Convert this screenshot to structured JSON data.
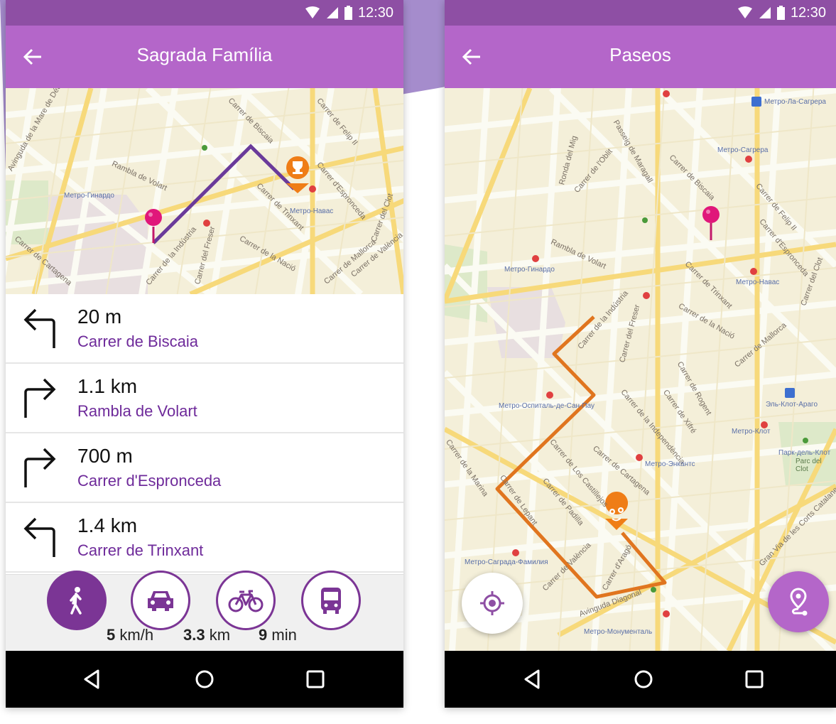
{
  "left_screen": {
    "status_time": "12:30",
    "title": "Sagrada Família",
    "map_labels": [
      {
        "text": "Avinguda de la Mare de Déu de Montserrat"
      },
      {
        "text": "Rambla de Volart"
      },
      {
        "text": "Carrer de Biscaia"
      },
      {
        "text": "Carrer de Trinxant"
      },
      {
        "text": "Carrer d'Espronceda"
      },
      {
        "text": "Carrer de Felip II"
      },
      {
        "text": "Carrer de la Nació"
      },
      {
        "text": "Carrer de la Indústria"
      },
      {
        "text": "Carrer del Freser"
      },
      {
        "text": "Carrer de Cartagena"
      },
      {
        "text": "Carrer de Mallorca"
      },
      {
        "text": "Carrer de València"
      },
      {
        "text": "Carrer del Clot"
      }
    ],
    "poi_labels": [
      "Метро-Гинардо",
      "Метро-Навас"
    ],
    "directions": [
      {
        "distance": "20 m",
        "street": "Carrer de Biscaia",
        "turn": "left-turn-icon"
      },
      {
        "distance": "1.1 km",
        "street": "Rambla de Volart",
        "turn": "right-turn-icon"
      },
      {
        "distance": "700 m",
        "street": "Carrer d'Espronceda",
        "turn": "right-turn-icon"
      },
      {
        "distance": "1.4 km",
        "street": "Carrer de Trinxant",
        "turn": "left-turn-icon"
      }
    ],
    "modes": [
      {
        "icon": "walking-icon",
        "active": true
      },
      {
        "icon": "car-icon",
        "active": false
      },
      {
        "icon": "bicycle-icon",
        "active": false
      },
      {
        "icon": "bus-icon",
        "active": false
      }
    ],
    "stats": {
      "speed_value": "5",
      "speed_unit": "km/h",
      "distance_value": "3.3",
      "distance_unit": "km",
      "time_value": "9",
      "time_unit": "min"
    }
  },
  "right_screen": {
    "status_time": "12:30",
    "title": "Paseos",
    "map_labels": [
      {
        "text": "Carrer de Biscaia"
      },
      {
        "text": "Passeig de Maragall"
      },
      {
        "text": "Carrer de l'Oblit"
      },
      {
        "text": "Ronda del Mig"
      },
      {
        "text": "Rambla de Volart"
      },
      {
        "text": "Carrer de Trinxant"
      },
      {
        "text": "Carrer de la Nació"
      },
      {
        "text": "Carrer de la Indústria"
      },
      {
        "text": "Carrer del Freser"
      },
      {
        "text": "Carrer de Rogent"
      },
      {
        "text": "Carrer de Xifré"
      },
      {
        "text": "Carrer de la Independència"
      },
      {
        "text": "Carrer de Los Castillejos"
      },
      {
        "text": "Carrer de Cartagena"
      },
      {
        "text": "Carrer de Padilla"
      },
      {
        "text": "Carrer de Lepant"
      },
      {
        "text": "Carrer de la Marina"
      },
      {
        "text": "Carrer de València"
      },
      {
        "text": "Carrer d'Aragó"
      },
      {
        "text": "Avinguda Diagonal"
      },
      {
        "text": "Gran Via de les Corts Catalanes"
      },
      {
        "text": "Carrer de Mallorca"
      },
      {
        "text": "Carrer de Felip II"
      },
      {
        "text": "Carrer d'Espronceda"
      },
      {
        "text": "Carrer del Clot"
      }
    ],
    "poi_labels": [
      "Метро-Ла-Сагрера",
      "Метро-Сагрера",
      "Метро-Гинардо",
      "Метро-Навас",
      "Метро-Оспиталь-де-Сан-Пау",
      "Метро-Энкантс",
      "Метро-Клот",
      "Эль-Клот-Араго",
      "Метро-Саграда-Фамилия",
      "Метро-Монументаль",
      "Парк-дель-Клот",
      "Parc del Clot"
    ]
  },
  "colors": {
    "statusbar": "#8e4fa4",
    "appbar": "#b466c9",
    "accent": "#7b3595",
    "route_left": "#6a3a9a",
    "route_right": "#e0751f",
    "pin": "#e0177a",
    "trophy_marker": "#ef7d17"
  }
}
